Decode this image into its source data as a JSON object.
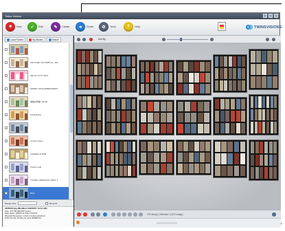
{
  "window": {
    "title": "Twins Visions",
    "controls": [
      "minimize",
      "maximize",
      "close"
    ]
  },
  "toolbar": {
    "items": [
      {
        "label": "New",
        "icon": "stop-icon",
        "color": "#d72a2a"
      },
      {
        "label": "Edit",
        "icon": "check-icon",
        "color": "#4caf2a"
      },
      {
        "label": "Create",
        "icon": "create-icon",
        "color": "#7a2c9c"
      },
      {
        "label": "Share",
        "icon": "share-icon",
        "color": "#2a7ccf"
      },
      {
        "label": "Tools",
        "icon": "tools-icon",
        "color": "#5a6575"
      },
      {
        "label": "Help",
        "icon": "help-icon",
        "color": "#e4c21b"
      }
    ],
    "logo_text": "TWINSVISIONS"
  },
  "sidebar": {
    "tabs": [
      {
        "label": "Local Folders",
        "color": "#3a7bd5"
      },
      {
        "label": "My Albums",
        "color": "#d33"
      },
      {
        "label": "Search",
        "color": "#3a7bd5"
      }
    ],
    "items": [
      {
        "label": "",
        "palette": [
          "#7ba0c8",
          "#d8c9a0",
          "#b05a4a"
        ]
      },
      {
        "label": "CROCHET PATTERN No. 282",
        "palette": [
          "#c9b59b",
          "#f2e7d5",
          "#8b6a4a"
        ]
      },
      {
        "label": "HELLO KITTY BOX",
        "palette": [
          "#e85d8c",
          "#f7c3d6",
          "#ffffff"
        ]
      },
      {
        "label": "SWEET HOLE EMBROIDERY",
        "palette": [
          "#d8c5b0",
          "#9b7d63",
          "#efe4d6"
        ]
      },
      {
        "label": "素敵な刺繍 VOL06",
        "palette": [
          "#a8c8a0",
          "#e8d8c0",
          "#6a8a5a"
        ]
      },
      {
        "label": "CUSHIONS",
        "palette": [
          "#d0a060",
          "#f2d9a8",
          "#8a5a30"
        ]
      },
      {
        "label": "",
        "palette": [
          "#7a8aa0",
          "#c0c8d4",
          "#404a5a"
        ]
      },
      {
        "label": "crochet cases",
        "palette": [
          "#c87a5a",
          "#eec0a8",
          "#7a3a2a"
        ]
      },
      {
        "label": "CANDELLE 2005",
        "palette": [
          "#e0d0a0",
          "#b8a070",
          "#fff6dc"
        ]
      },
      {
        "label": "Punta mode",
        "palette": [
          "#9aa0c8",
          "#d8dcf0",
          "#5a6090"
        ]
      },
      {
        "label": "TUUDEY ZERIAGOC TERO 4",
        "palette": [
          "#c8a8c8",
          "#f0e0f0",
          "#806080"
        ]
      },
      {
        "label": "BAO",
        "palette": [
          "#40607a",
          "#8ab0d0",
          "#1a2a3a"
        ],
        "selected": true
      }
    ],
    "bottom": {
      "display_size_label": "Display Size",
      "show_all_label": "Show All"
    },
    "info": {
      "filename": "40052010.jpg (Modified: 2/30/2007, 12:14 AM)",
      "lines": [
        "Size: 372 KB (380,810 bytes)",
        "Date taken: 2005/1/11 (Sat) 1:00 PM",
        "Physical Dimension: 4.9x6.1 inches (24x32 in)",
        "Pixel Format: 24 bits per pixel (RGB8-bit)"
      ]
    }
  },
  "viewer": {
    "top_label": "Sort By",
    "footer_label": "175 item(s) | Selected: 1 (372 image)",
    "panels_palette": [
      "#d6c7a8",
      "#a5887a",
      "#e8e1d2",
      "#8b6f5a",
      "#c94a3a",
      "#6f8aa8",
      "#f0ebe1",
      "#b9a58c"
    ]
  },
  "accent_colors": {
    "selected": "#3a78d4",
    "titlebar": "#4b5668"
  }
}
